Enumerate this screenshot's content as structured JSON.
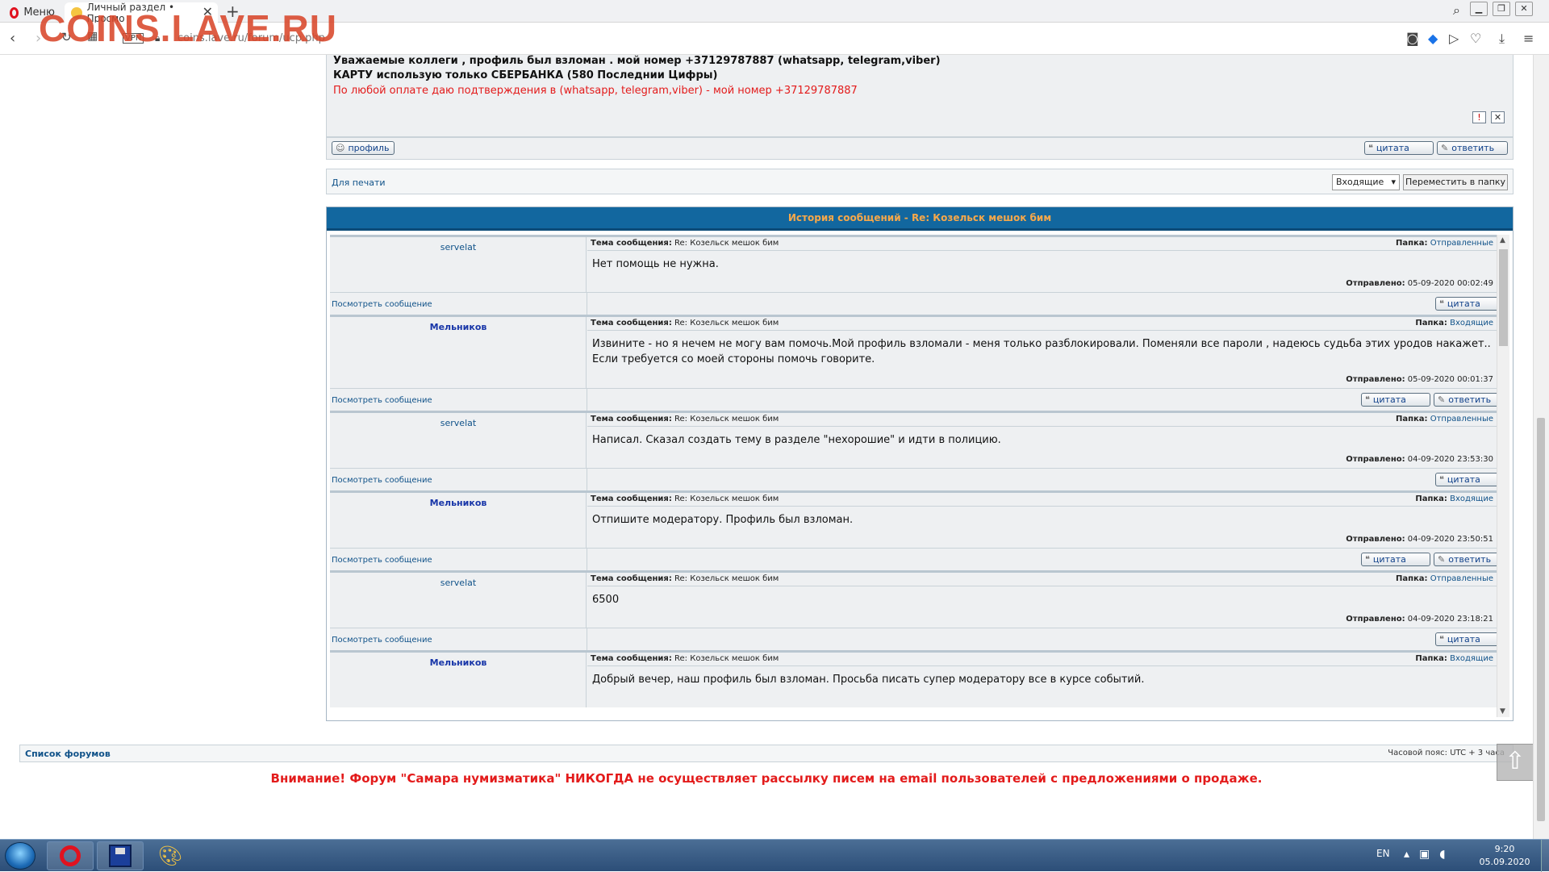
{
  "browser": {
    "menu_label": "Меню",
    "tab_title": "Личный раздел • Просмо",
    "tab_close": "✕",
    "new_tab": "+",
    "url": "coins.lave.ru/forum/ucp.php",
    "vpn": "VPN",
    "watermark": "COINS.LAVE.RU"
  },
  "top_message": {
    "line1": "Уважаемые коллеги , профиль был взломан . мой номер +37129787887 (whatsapp, telegram,viber)",
    "line2": "КАРТУ использую только СБЕРБАНКА (580 Последнии Цифры)",
    "line3": "По любой оплате даю подтверждения в (whatsapp, telegram,viber) - мой номер +37129787887",
    "profile_btn": "профиль",
    "quote_btn": "цитата",
    "reply_btn": "ответить"
  },
  "print_row": {
    "print_link": "Для печати",
    "folder_select": "Входящие",
    "move_btn": "Переместить в папку"
  },
  "history": {
    "title": "История сообщений - Re: Козельск мешок бим",
    "subject_label": "Тема сообщения:",
    "folder_label": "Папка:",
    "sent_label": "Отправлено:",
    "view_link": "Посмотреть сообщение",
    "quote_btn": "цитата",
    "reply_btn": "ответить",
    "entries": [
      {
        "author": "servelat",
        "subject": "Re: Козельск мешок бим",
        "folder": "Отправленные",
        "text": "Нет помощь не нужна.",
        "sent": "05-09-2020 00:02:49"
      },
      {
        "author": "Мельников",
        "subject": "Re: Козельск мешок бим",
        "folder": "Входящие",
        "text": "Извините - но я нечем не могу вам помочь.Мой профиль взломали - меня только разблокировали. Поменяли все пароли , надеюсь судьба этих уродов накажет.. Если требуется со моей стороны помочь говорите.",
        "sent": "05-09-2020 00:01:37"
      },
      {
        "author": "servelat",
        "subject": "Re: Козельск мешок бим",
        "folder": "Отправленные",
        "text": "Написал. Сказал создать тему в разделе \"нехорошие\" и идти в полицию.",
        "sent": "04-09-2020 23:53:30"
      },
      {
        "author": "Мельников",
        "subject": "Re: Козельск мешок бим",
        "folder": "Входящие",
        "text": "Отпишите модератору. Профиль был взломан.",
        "sent": "04-09-2020 23:50:51"
      },
      {
        "author": "servelat",
        "subject": "Re: Козельск мешок бим",
        "folder": "Отправленные",
        "text": "6500",
        "sent": "04-09-2020 23:18:21"
      },
      {
        "author": "Мельников",
        "subject": "Re: Козельск мешок бим",
        "folder": "Входящие",
        "text": "Добрый вечер, наш профиль был взломан. Просьба писать супер модератору все в курсе событий.",
        "sent": ""
      }
    ]
  },
  "footer": {
    "forum_list": "Список форумов",
    "timezone": "Часовой пояс: UTC + 3 часа",
    "warning": "Внимание! Форум \"Самара нумизматика\" НИКОГДА не осуществляет рассылку писем на email пользователей с предложениями о продаже."
  },
  "taskbar": {
    "lang": "EN",
    "time": "9:20",
    "date": "05.09.2020"
  }
}
